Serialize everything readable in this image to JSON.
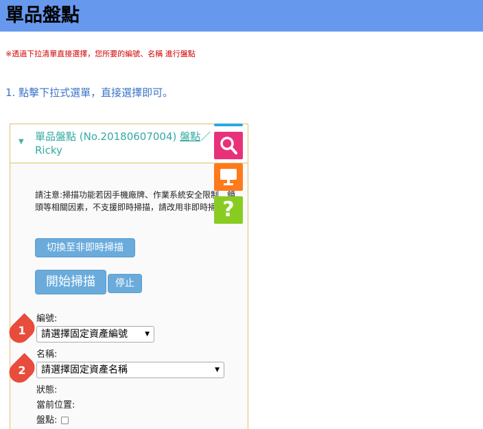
{
  "page": {
    "title": "單品盤點",
    "notice": "※透過下拉清單直接選擇，您所要的編號、名稱 進行盤點",
    "step": "1. 點擊下拉式選單，直接選擇即可。"
  },
  "panel": {
    "title_plain": "單品盤點 (No.20180607004) ",
    "title_link": "盤點",
    "title_user": "Ricky",
    "note": "請注意:掃描功能若因手機廠牌、作業系統安全限制、鏡頭等相關因素，不支援即時掃描，請改用非即時掃描",
    "btn_offline": "切換至非即時掃描",
    "btn_start": "開始掃描",
    "btn_stop": "停止",
    "label_id": "編號:",
    "select_id": "請選擇固定資產編號",
    "label_name": "名稱:",
    "select_name": "請選擇固定資產名稱",
    "label_status": "狀態:",
    "label_location": "當前位置:",
    "label_check": "盤點:"
  },
  "markers": [
    "1",
    "2"
  ],
  "side_tools": [
    {
      "icon": "search-icon",
      "color": "#e8317a"
    },
    {
      "icon": "monitor-icon",
      "color": "#ff7a1a"
    },
    {
      "icon": "help-icon",
      "label": "?",
      "color": "#88cc22"
    }
  ]
}
